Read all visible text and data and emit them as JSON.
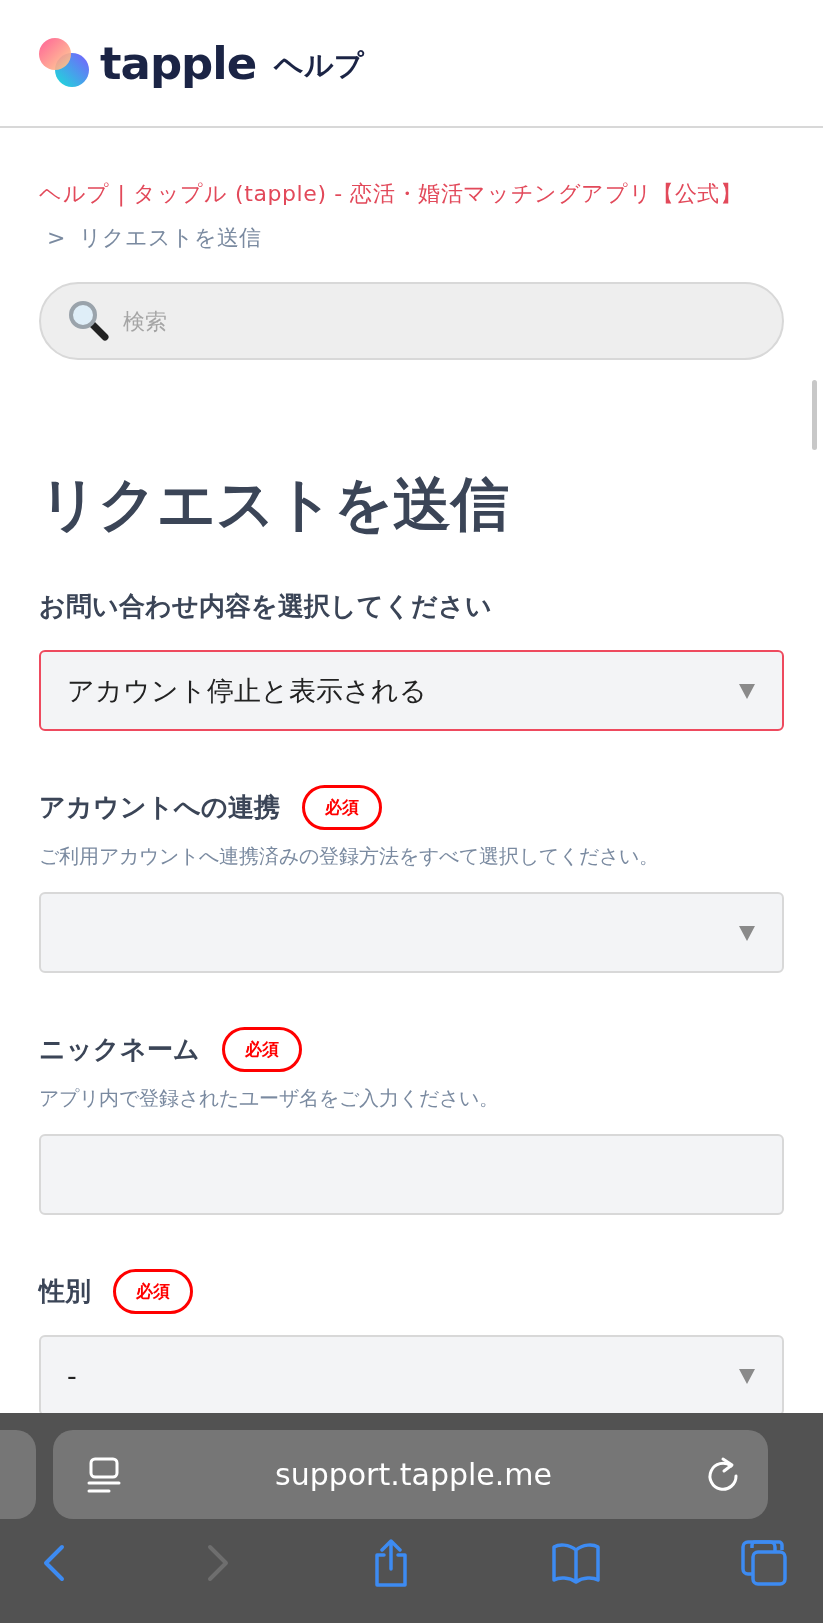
{
  "header": {
    "logo_text": "tapple",
    "section": "ヘルプ"
  },
  "breadcrumb": {
    "items": [
      {
        "label": "ヘルプ | タップル (tapple) - 恋活・婚活マッチングアプリ【公式】",
        "kind": "link"
      },
      {
        "label": "リクエストを送信",
        "kind": "current"
      }
    ],
    "separator": ">"
  },
  "search": {
    "placeholder": "検索"
  },
  "page_title": "リクエストを送信",
  "fields": [
    {
      "kind": "select",
      "label": "お問い合わせ内容を選択してください",
      "required": false,
      "value": "アカウント停止と表示される",
      "highlighted": true
    },
    {
      "kind": "select",
      "label": "アカウントへの連携",
      "required": true,
      "hint": "ご利用アカウントへ連携済みの登録方法をすべて選択してください。",
      "highlighted": false
    },
    {
      "kind": "input",
      "label": "ニックネーム",
      "required": true,
      "hint": "アプリ内で登録されたユーザ名をご入力ください。",
      "highlighted": false
    },
    {
      "kind": "select",
      "label": "性別",
      "required": true,
      "value": "-",
      "highlighted": false
    }
  ],
  "required_badge": [
    "必須",
    "必須",
    "必須"
  ],
  "browser": {
    "url": "support.tapple.me",
    "forward_disabled": true
  }
}
